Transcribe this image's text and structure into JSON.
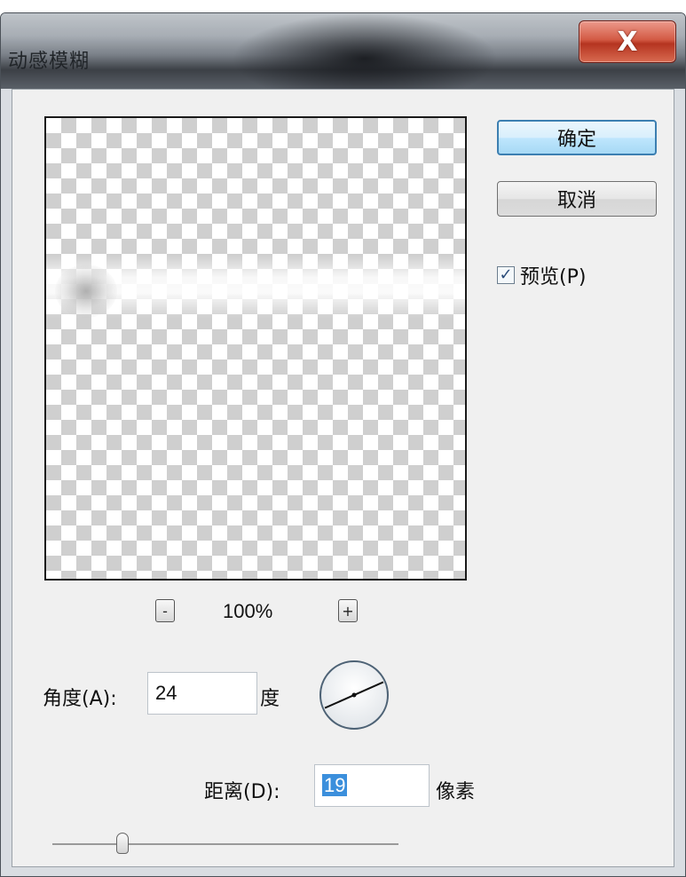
{
  "dialog": {
    "title": "动感模糊",
    "close_label": "X"
  },
  "buttons": {
    "ok_label": "确定",
    "cancel_label": "取消"
  },
  "preview_option": {
    "checked": true,
    "label": "预览(P)"
  },
  "zoom": {
    "minus_label": "-",
    "plus_label": "+",
    "level": "100%"
  },
  "angle": {
    "label": "角度(A):",
    "value": "24",
    "unit": "度"
  },
  "distance": {
    "label": "距离(D):",
    "value": "19",
    "unit": "像素"
  },
  "slider": {
    "fraction": 0.1
  }
}
